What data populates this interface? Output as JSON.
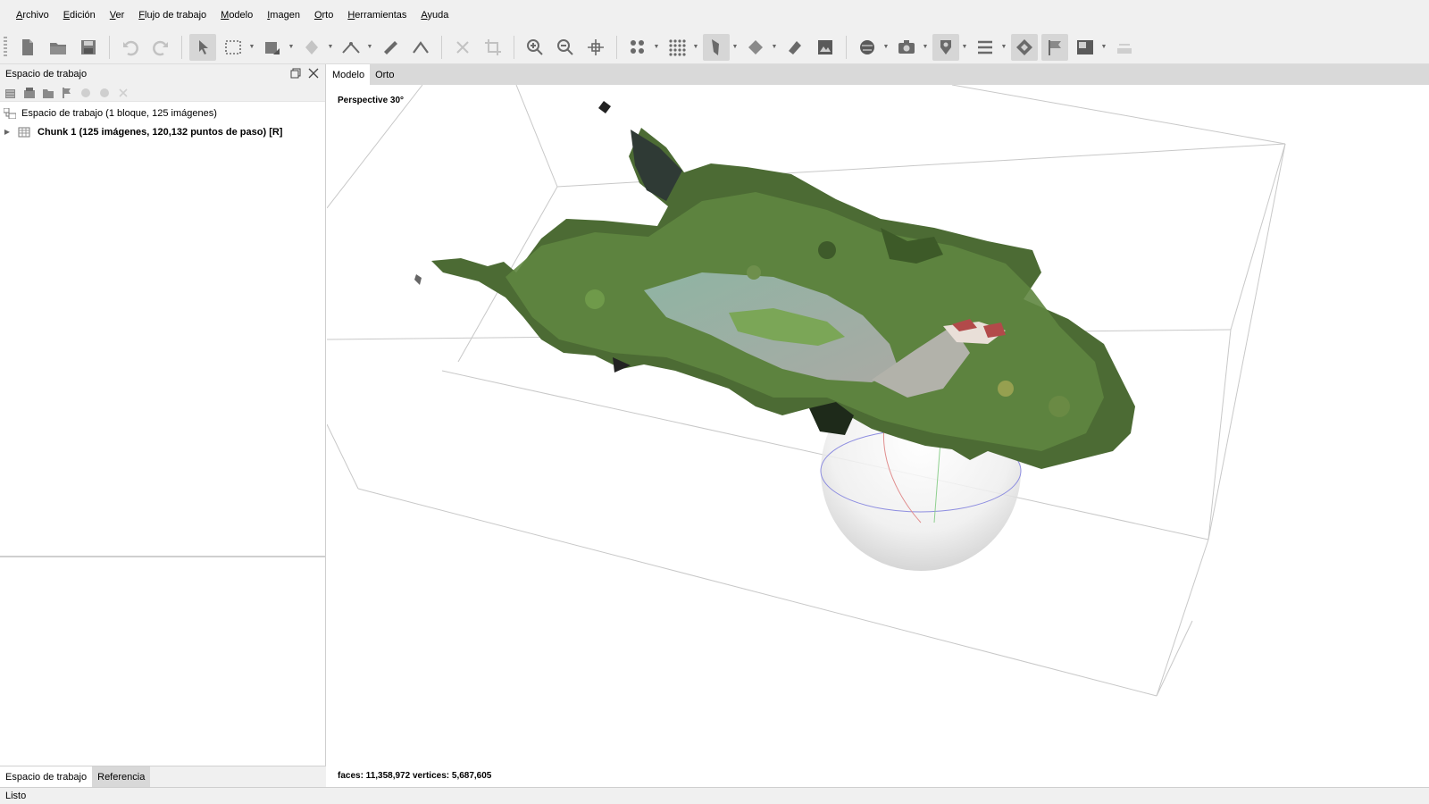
{
  "menu": [
    "Archivo",
    "Edición",
    "Ver",
    "Flujo de trabajo",
    "Modelo",
    "Imagen",
    "Orto",
    "Herramientas",
    "Ayuda"
  ],
  "workspace": {
    "title": "Espacio de trabajo",
    "root_label": "Espacio de trabajo (1 bloque, 125 imágenes)",
    "chunk_label": "Chunk 1 (125 imágenes, 120,132 puntos de paso) [R]"
  },
  "left_tabs": [
    "Espacio de trabajo",
    "Referencia"
  ],
  "view_tabs": [
    "Modelo",
    "Orto"
  ],
  "viewport": {
    "projection_label": "Perspective 30°",
    "stats_label": "faces: 11,358,972 vertices: 5,687,605"
  },
  "status": "Listo",
  "toolbar_icons": [
    "new-document-icon",
    "open-folder-icon",
    "save-icon",
    "undo-icon",
    "redo-icon",
    "navigation-arrow-icon",
    "rectangle-selection-icon",
    "resize-region-icon",
    "rotate-object-icon",
    "ruler-icon",
    "draw-polyline-icon",
    "delete-selection-icon",
    "crop-icon",
    "zoom-in-icon",
    "zoom-out-icon",
    "reset-view-icon",
    "point-cloud-icon",
    "dense-cloud-icon",
    "shaded-model-icon",
    "solid-model-icon",
    "textured-model-icon",
    "tiled-model-icon",
    "dem-icon",
    "show-cameras-icon",
    "show-markers-icon",
    "show-region-icon",
    "show-shapes-icon",
    "show-grid-icon",
    "show-labels-icon",
    "show-images-icon",
    "overlay-icon"
  ]
}
